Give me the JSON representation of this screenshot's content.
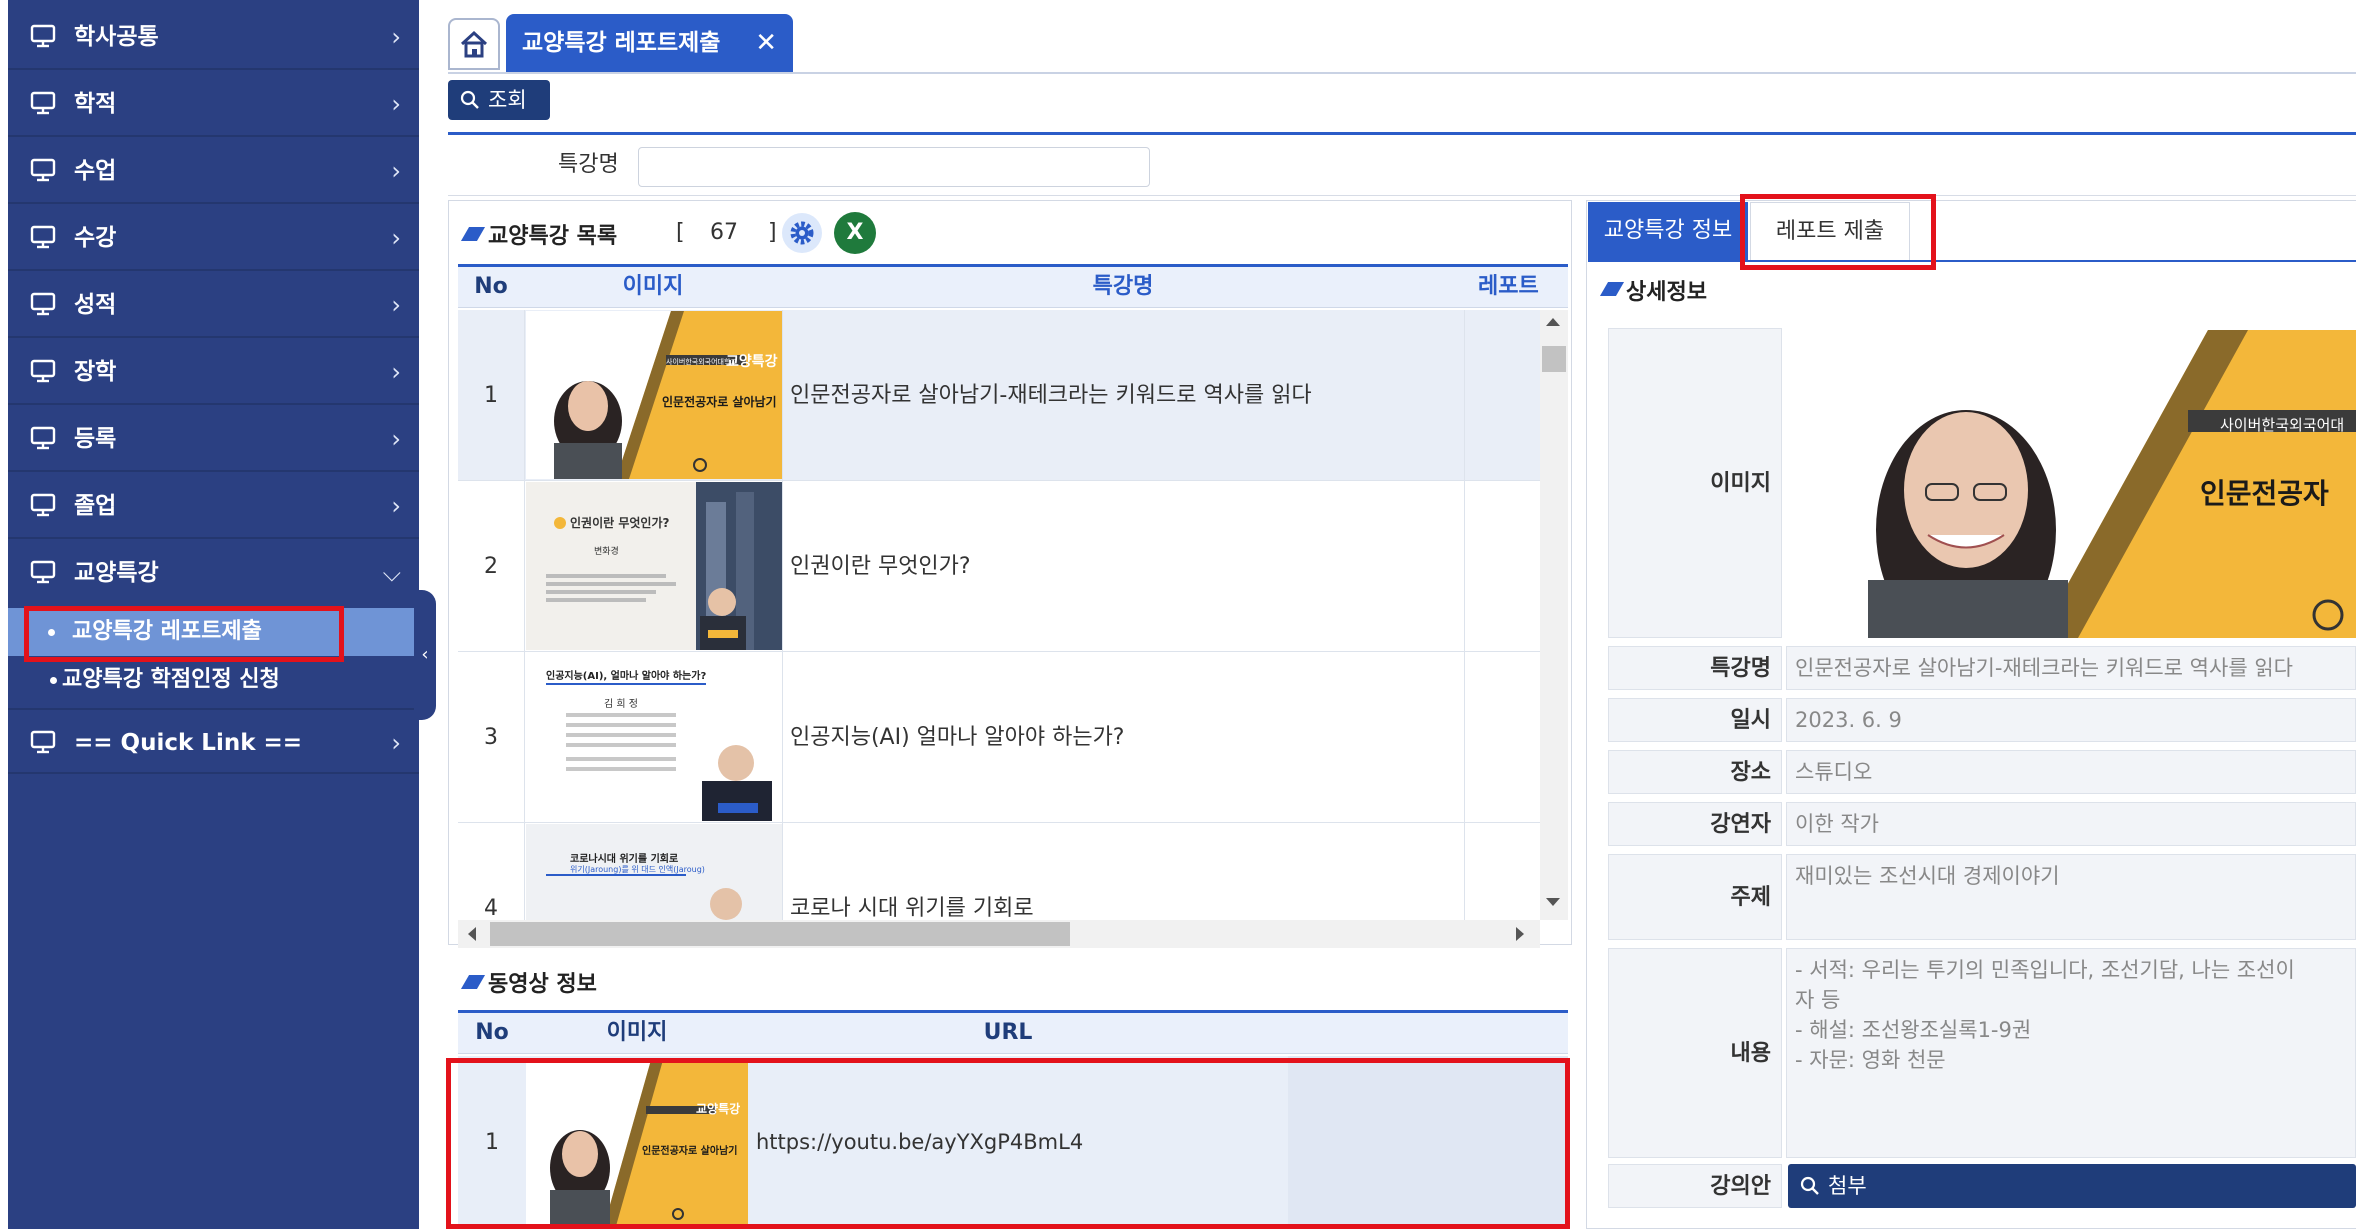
{
  "sidebar": {
    "items": [
      {
        "label": "학사공통"
      },
      {
        "label": "학적"
      },
      {
        "label": "수업"
      },
      {
        "label": "수강"
      },
      {
        "label": "성적"
      },
      {
        "label": "장학"
      },
      {
        "label": "등록"
      },
      {
        "label": "졸업"
      },
      {
        "label": "교양특강"
      }
    ],
    "subitems": [
      {
        "label": "교양특강 레포트제출",
        "active": true
      },
      {
        "label": "교양특강 학점인정 신청",
        "active": false
      }
    ],
    "quicklink": "== Quick Link =="
  },
  "tabs": {
    "active_label": "교양특강 레포트제출",
    "close": "✕"
  },
  "toolbar": {
    "search_label": "조회"
  },
  "filter": {
    "label": "특강명",
    "value": ""
  },
  "list": {
    "title": "교양특강 목록",
    "count_open": "[",
    "count": "67",
    "count_close": "]",
    "excel_icon": "X",
    "headers": {
      "no": "No",
      "image": "이미지",
      "name": "특강명",
      "report": "레포트"
    },
    "rows": [
      {
        "no": "1",
        "name": "인문전공자로 살아남기-재테크라는 키워드로 역사를 읽다"
      },
      {
        "no": "2",
        "name": "인권이란 무엇인가?"
      },
      {
        "no": "3",
        "name": "인공지능(AI) 얼마나 알아야 하는가?"
      },
      {
        "no": "4",
        "name": "코로나 시대 위기를 기회로"
      }
    ],
    "thumb_texts": {
      "t1_small": "사이버한국외국어대학교",
      "t1_big": "교양특강",
      "t1_title": "인문전공자로 살아남기",
      "t2_title": "인권이란 무엇인가?",
      "t2_sub": "변화경",
      "t3_title": "인공지능(AI), 얼마나 알아야 하는가?",
      "t3_name": "김 희 정",
      "t4_title": "코로나시대 위기를 기회로",
      "t4_sub": "위기(Jaroung)를 위 대드 인액(Jaroug)"
    }
  },
  "video": {
    "title": "동영상 정보",
    "headers": {
      "no": "No",
      "image": "이미지",
      "url": "URL"
    },
    "rows": [
      {
        "no": "1",
        "url": "https://youtu.be/ayYXgP4BmL4"
      }
    ]
  },
  "detail": {
    "tab_info": "교양특강 정보",
    "tab_report": "레포트 제출",
    "title": "상세정보",
    "image_label": "이미지",
    "preview_small": "사이버한국외국어대",
    "preview_big": "인문전공자",
    "fields": {
      "name_label": "특강명",
      "name_value": "인문전공자로 살아남기-재테크라는 키워드로 역사를 읽다",
      "date_label": "일시",
      "date_value": "2023. 6. 9",
      "place_label": "장소",
      "place_value": "스튜디오",
      "speaker_label": "강연자",
      "speaker_value": "이한 작가",
      "topic_label": "주제",
      "topic_value": "재미있는 조선시대 경제이야기",
      "content_label": "내용",
      "content_lines": [
        "- 서적: 우리는 투기의 민족입니다, 조선기담, 나는 조선이",
        "자 등",
        "- 해설: 조선왕조실록1-9권",
        "- 자문: 영화 천문"
      ],
      "syllabus_label": "강의안",
      "syllabus_button": "첨부"
    }
  },
  "colors": {
    "sidebar": "#2b4082",
    "accent": "#2b5cc8",
    "highlight": "#e3121b",
    "thumb_gold": "#f3b73a"
  }
}
